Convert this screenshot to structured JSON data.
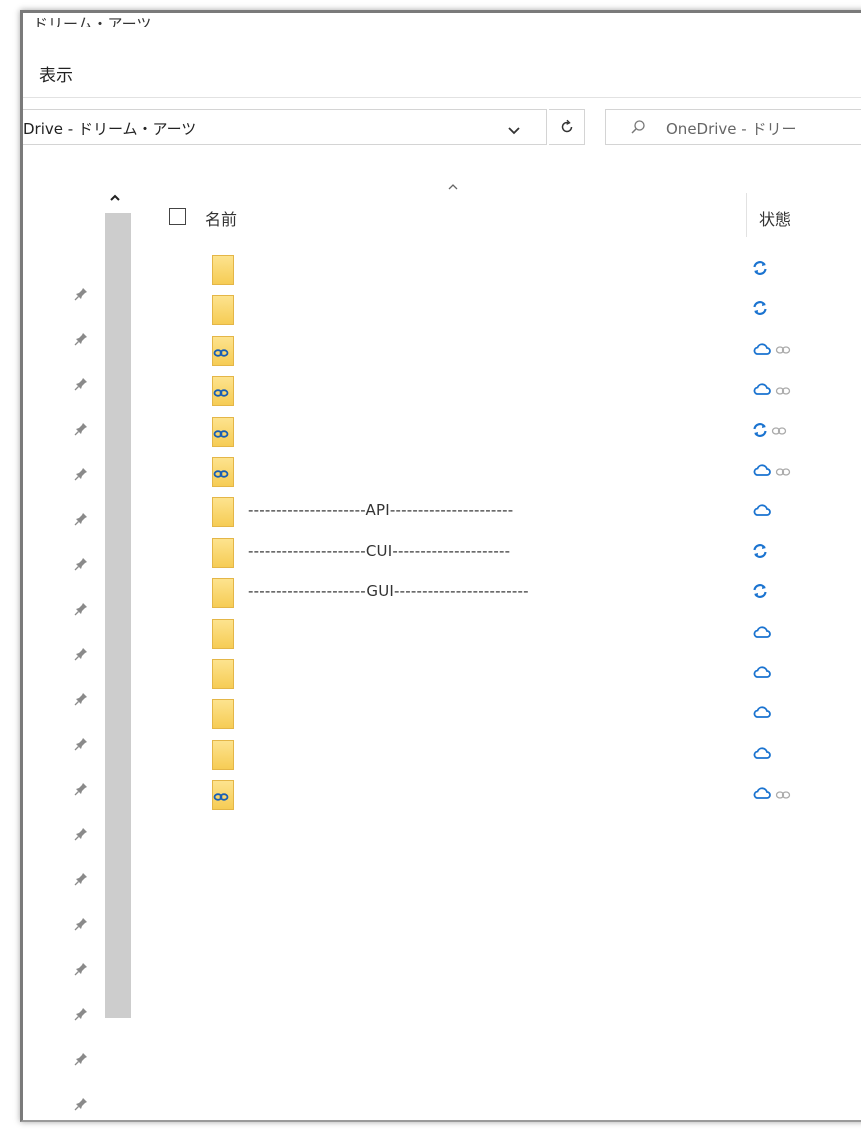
{
  "window": {
    "title_partial": "ドリーム・アーツ"
  },
  "menu": {
    "view_label": "表示"
  },
  "address_bar": {
    "path": "Drive - ドリーム・アーツ",
    "dropdown_icon": "chevron-down-icon",
    "refresh_icon": "refresh-icon"
  },
  "search": {
    "placeholder": "OneDrive - ドリー",
    "icon": "search-icon"
  },
  "columns": {
    "name": "名前",
    "status": "状態"
  },
  "rows": [
    {
      "name": "",
      "folder_type": "folder",
      "status": "syncing",
      "shared": false
    },
    {
      "name": "",
      "folder_type": "folder",
      "status": "syncing",
      "shared": false
    },
    {
      "name": "",
      "folder_type": "shared-folder",
      "status": "cloud",
      "shared": true
    },
    {
      "name": "",
      "folder_type": "shared-folder",
      "status": "cloud",
      "shared": true
    },
    {
      "name": "",
      "folder_type": "shared-folder",
      "status": "syncing",
      "shared": true
    },
    {
      "name": "",
      "folder_type": "shared-folder",
      "status": "cloud",
      "shared": true
    },
    {
      "name": "---------------------API----------------------",
      "folder_type": "folder",
      "status": "cloud",
      "shared": false
    },
    {
      "name": "---------------------CUI---------------------",
      "folder_type": "folder",
      "status": "syncing",
      "shared": false
    },
    {
      "name": "---------------------GUI------------------------",
      "folder_type": "folder",
      "status": "syncing",
      "shared": false
    },
    {
      "name": "",
      "folder_type": "folder",
      "status": "cloud",
      "shared": false
    },
    {
      "name": "",
      "folder_type": "folder",
      "status": "cloud",
      "shared": false
    },
    {
      "name": "",
      "folder_type": "folder",
      "status": "cloud",
      "shared": false
    },
    {
      "name": "",
      "folder_type": "folder",
      "status": "cloud",
      "shared": false
    },
    {
      "name": "",
      "folder_type": "shared-folder",
      "status": "cloud",
      "shared": true
    }
  ],
  "nav_pane": {
    "pinned_count": 19
  },
  "colors": {
    "accent": "#1a73d0",
    "folder": "#f6cc55",
    "scrollbar": "#cdcdcd"
  }
}
